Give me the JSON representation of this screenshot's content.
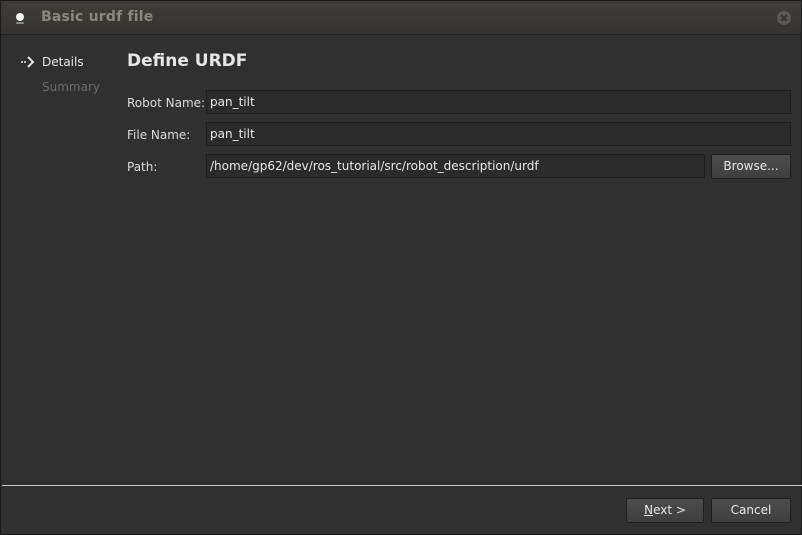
{
  "window": {
    "title": "Basic urdf file"
  },
  "steps": [
    {
      "label": "Details",
      "active": true
    },
    {
      "label": "Summary",
      "active": false
    }
  ],
  "page": {
    "title": "Define URDF"
  },
  "form": {
    "robot_name_label": "Robot Name:",
    "robot_name_value": "pan_tilt",
    "file_name_label": "File Name:",
    "file_name_value": "pan_tilt",
    "path_label": "Path:",
    "path_value": "/home/gp62/dev/ros_tutorial/src/robot_description/urdf",
    "browse_label": "Browse..."
  },
  "footer": {
    "next_mnemonic": "N",
    "next_rest": "ext >",
    "cancel_label": "Cancel"
  },
  "icons": {
    "app": "app-icon",
    "close": "close-icon",
    "step": "step-arrow-icon"
  }
}
